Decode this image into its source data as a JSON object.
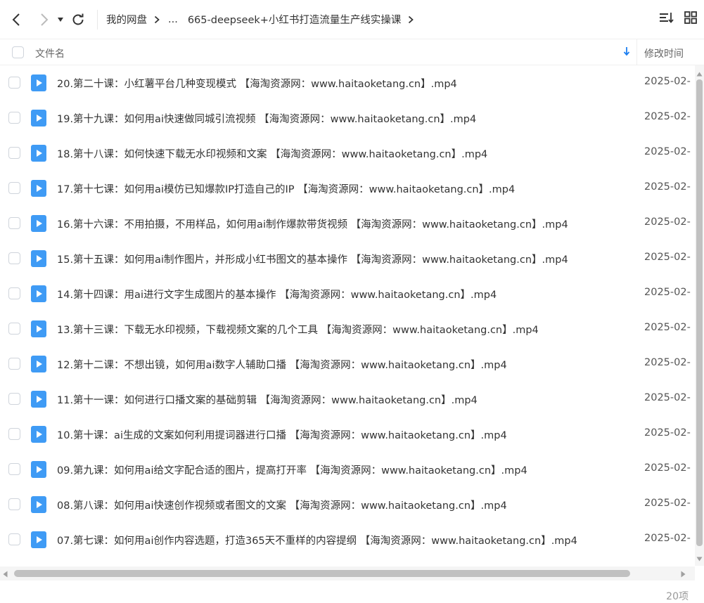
{
  "toolbar": {
    "breadcrumbs": [
      "我的网盘",
      "...",
      "665-deepseek+小红书打造流量生产线实操课"
    ]
  },
  "header": {
    "name_label": "文件名",
    "time_label": "修改时间"
  },
  "files": [
    {
      "name": "20.第二十课：小红薯平台几种变现模式 【海淘资源网：www.haitaoketang.cn】.mp4",
      "time": "2025-02-"
    },
    {
      "name": "19.第十九课：如何用ai快速做同城引流视频 【海淘资源网：www.haitaoketang.cn】.mp4",
      "time": "2025-02-"
    },
    {
      "name": "18.第十八课：如何快速下载无水印视频和文案 【海淘资源网：www.haitaoketang.cn】.mp4",
      "time": "2025-02-"
    },
    {
      "name": "17.第十七课：如何用ai模仿已知爆款IP打造自己的IP 【海淘资源网：www.haitaoketang.cn】.mp4",
      "time": "2025-02-"
    },
    {
      "name": "16.第十六课：不用拍摄，不用样品，如何用ai制作爆款带货视频 【海淘资源网：www.haitaoketang.cn】.mp4",
      "time": "2025-02-"
    },
    {
      "name": "15.第十五课：如何用ai制作图片，并形成小红书图文的基本操作 【海淘资源网：www.haitaoketang.cn】.mp4",
      "time": "2025-02-"
    },
    {
      "name": "14.第十四课：用ai进行文字生成图片的基本操作 【海淘资源网：www.haitaoketang.cn】.mp4",
      "time": "2025-02-"
    },
    {
      "name": "13.第十三课：下载无水印视频，下载视频文案的几个工具 【海淘资源网：www.haitaoketang.cn】.mp4",
      "time": "2025-02-"
    },
    {
      "name": "12.第十二课：不想出镜，如何用ai数字人辅助口播 【海淘资源网：www.haitaoketang.cn】.mp4",
      "time": "2025-02-"
    },
    {
      "name": "11.第十一课：如何进行口播文案的基础剪辑 【海淘资源网：www.haitaoketang.cn】.mp4",
      "time": "2025-02-"
    },
    {
      "name": "10.第十课：ai生成的文案如何利用提词器进行口播 【海淘资源网：www.haitaoketang.cn】.mp4",
      "time": "2025-02-"
    },
    {
      "name": "09.第九课：如何用ai给文字配合适的图片，提高打开率 【海淘资源网：www.haitaoketang.cn】.mp4",
      "time": "2025-02-"
    },
    {
      "name": "08.第八课：如何用ai快速创作视频或者图文的文案 【海淘资源网：www.haitaoketang.cn】.mp4",
      "time": "2025-02-"
    },
    {
      "name": "07.第七课：如何用ai创作内容选题，打造365天不重样的内容提纲 【海淘资源网：www.haitaoketang.cn】.mp4",
      "time": "2025-02-"
    }
  ],
  "footer": {
    "count": "20项"
  },
  "colors": {
    "video_icon": "#3f9bf5",
    "sort_arrow": "#1e7ff0"
  }
}
